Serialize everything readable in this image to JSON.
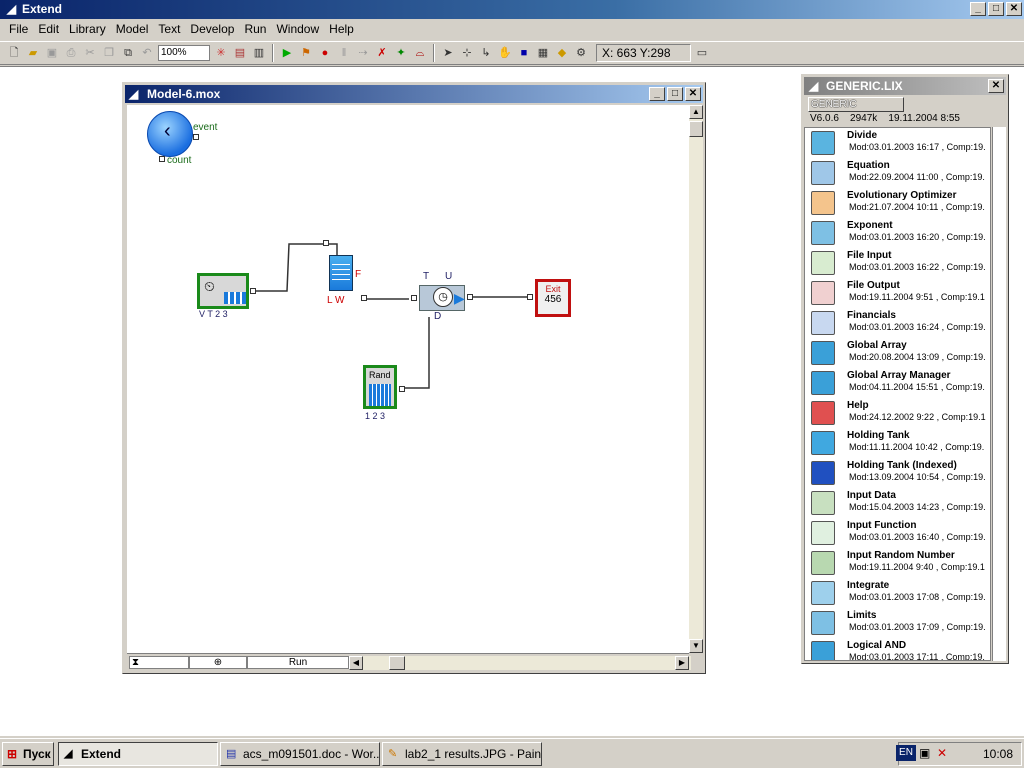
{
  "app": {
    "title": "Extend"
  },
  "menu": [
    "File",
    "Edit",
    "Library",
    "Model",
    "Text",
    "Develop",
    "Run",
    "Window",
    "Help"
  ],
  "toolbar": {
    "zoom": "100%",
    "coords": "X: 663 Y:298"
  },
  "model_window": {
    "title": "Model-6.mox",
    "status_run": "Run",
    "blocks": {
      "timer_event": "event",
      "timer_count": "count",
      "gen_ports": "V T 2 3",
      "queue_ports": "L W",
      "queue_f": "F",
      "activity_t": "T",
      "activity_u": "U",
      "activity_d": "D",
      "rand_label": "Rand",
      "rand_ports": "1 2 3",
      "exit_label": "Exit",
      "exit_count": "456"
    }
  },
  "library": {
    "title": "GENERIC.LIX",
    "selector": "GENERIC",
    "version": "V6.0.6",
    "size": "2947k",
    "date": "19.11.2004 8:55",
    "items": [
      {
        "name": "Divide",
        "mod": "Mod:03.01.2003 16:17 , Comp:19.",
        "icon": "divide-icon",
        "color": "#5ab4e0"
      },
      {
        "name": "Equation",
        "mod": "Mod:22.09.2004 11:00 , Comp:19.",
        "icon": "equation-icon",
        "color": "#9fc7e8"
      },
      {
        "name": "Evolutionary Optimizer",
        "mod": "Mod:21.07.2004 10:11 , Comp:19.",
        "icon": "optimizer-icon",
        "color": "#f4c48c"
      },
      {
        "name": "Exponent",
        "mod": "Mod:03.01.2003 16:20 , Comp:19.",
        "icon": "exponent-icon",
        "color": "#7ec0e4"
      },
      {
        "name": "File Input",
        "mod": "Mod:03.01.2003 16:22 , Comp:19.",
        "icon": "file-input-icon",
        "color": "#d8ecd0"
      },
      {
        "name": "File Output",
        "mod": "Mod:19.11.2004 9:51 , Comp:19.1",
        "icon": "file-output-icon",
        "color": "#f0d0d0"
      },
      {
        "name": "Financials",
        "mod": "Mod:03.01.2003 16:24 , Comp:19.",
        "icon": "financials-icon",
        "color": "#c8d8f0"
      },
      {
        "name": "Global Array",
        "mod": "Mod:20.08.2004 13:09 , Comp:19.",
        "icon": "global-array-icon",
        "color": "#3aa0d8"
      },
      {
        "name": "Global Array Manager",
        "mod": "Mod:04.11.2004 15:51 , Comp:19.",
        "icon": "global-array-manager-icon",
        "color": "#3aa0d8"
      },
      {
        "name": "Help",
        "mod": "Mod:24.12.2002 9:22 , Comp:19.1",
        "icon": "help-icon",
        "color": "#e05050"
      },
      {
        "name": "Holding Tank",
        "mod": "Mod:11.11.2004 10:42 , Comp:19.",
        "icon": "holding-tank-icon",
        "color": "#40a8e0"
      },
      {
        "name": "Holding Tank (Indexed)",
        "mod": "Mod:13.09.2004 10:54 , Comp:19.",
        "icon": "holding-tank-indexed-icon",
        "color": "#2050c0"
      },
      {
        "name": "Input Data",
        "mod": "Mod:15.04.2003 14:23 , Comp:19.",
        "icon": "input-data-icon",
        "color": "#c8e0c0"
      },
      {
        "name": "Input Function",
        "mod": "Mod:03.01.2003 16:40 , Comp:19.",
        "icon": "input-function-icon",
        "color": "#e0f0e0"
      },
      {
        "name": "Input Random Number",
        "mod": "Mod:19.11.2004 9:40 , Comp:19.1",
        "icon": "input-random-icon",
        "color": "#b8d8b0"
      },
      {
        "name": "Integrate",
        "mod": "Mod:03.01.2003 17:08 , Comp:19.",
        "icon": "integrate-icon",
        "color": "#9ed0ec"
      },
      {
        "name": "Limits",
        "mod": "Mod:03.01.2003 17:09 , Comp:19.",
        "icon": "limits-icon",
        "color": "#7ec0e4"
      },
      {
        "name": "Logical AND",
        "mod": "Mod:03.01.2003 17:11 , Comp:19.",
        "icon": "logical-and-icon",
        "color": "#3aa0d8"
      }
    ]
  },
  "taskbar": {
    "start": "Пуск",
    "tasks": [
      {
        "label": "Extend",
        "active": true
      },
      {
        "label": "acs_m091501.doc - Wor...",
        "active": false
      },
      {
        "label": "lab2_1 results.JPG - Paint",
        "active": false
      }
    ],
    "lang": "EN",
    "tray_chevron": "«",
    "clock": "10:08"
  }
}
